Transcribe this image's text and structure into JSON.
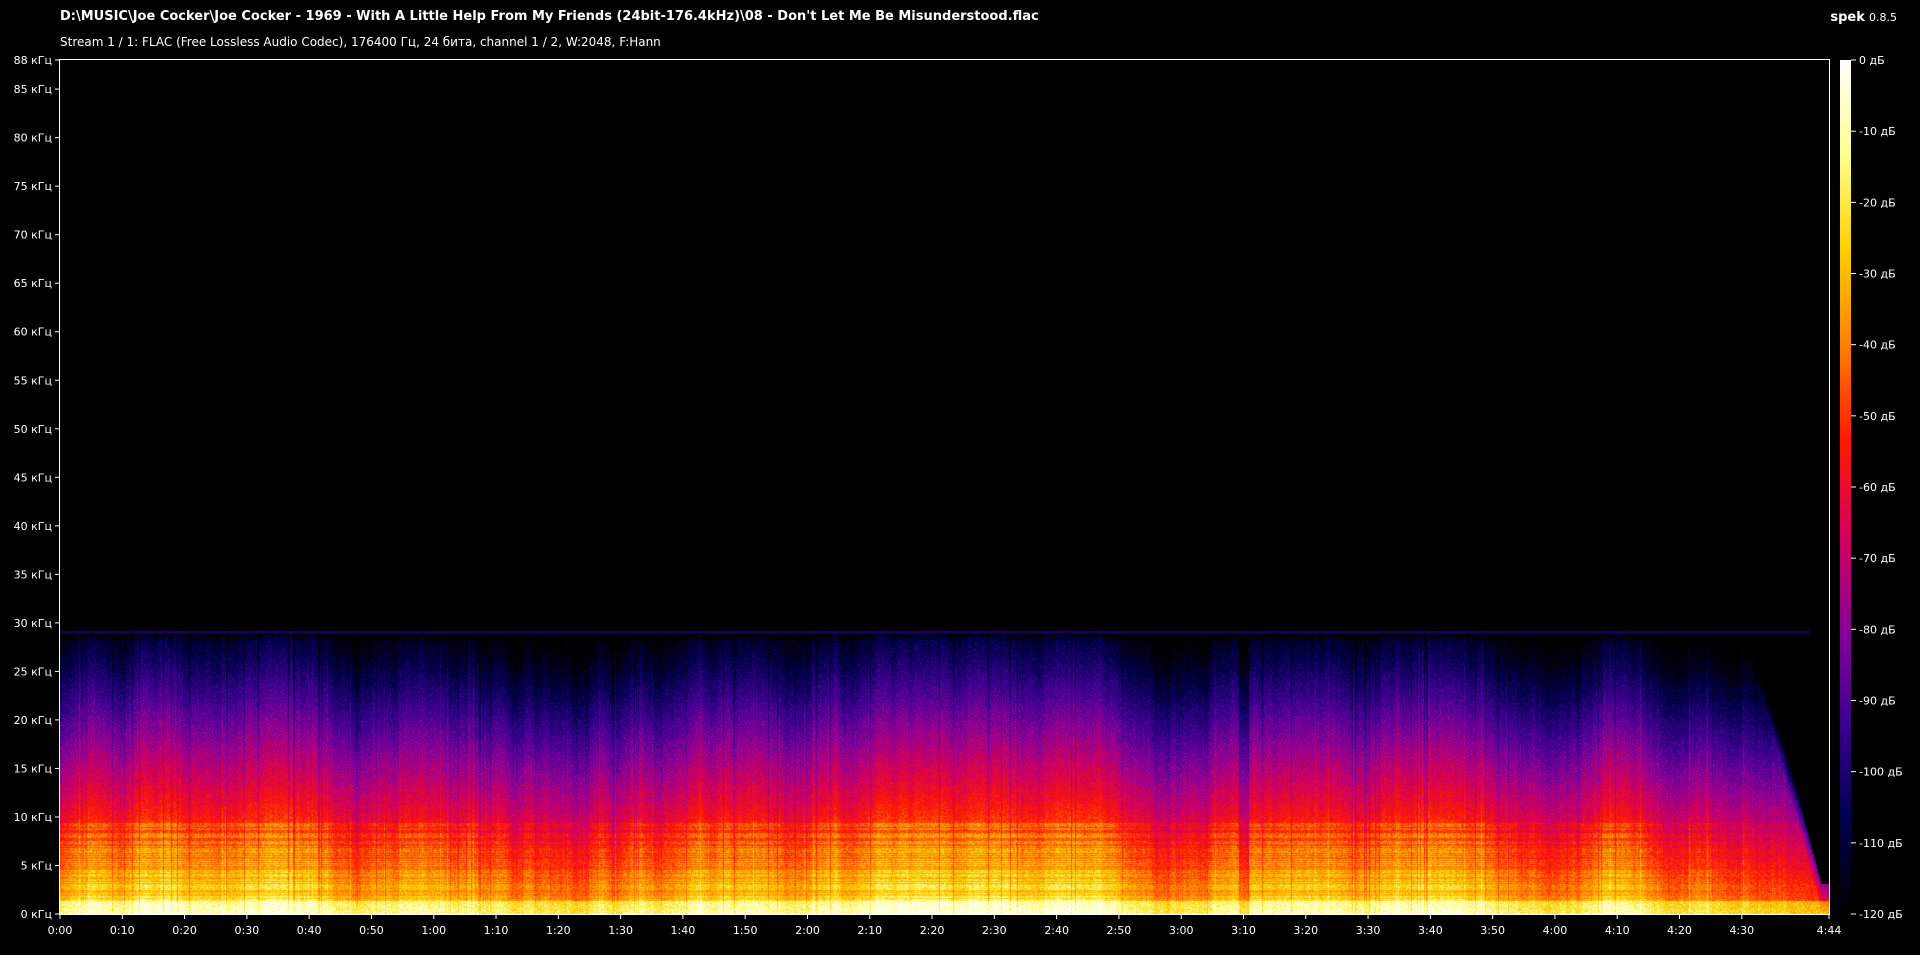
{
  "header": {
    "file_path": "D:\\MUSIC\\Joe Cocker\\Joe Cocker - 1969 - With A Little Help From My Friends (24bit-176.4kHz)\\08 - Don't Let Me Be Misunderstood.flac",
    "stream_info": "Stream 1 / 1: FLAC (Free Lossless Audio Codec), 176400 Гц, 24 бита, channel 1 / 2, W:2048, F:Hann",
    "app_name": "spek",
    "app_version": "0.8.5"
  },
  "chart_data": {
    "type": "heatmap",
    "x_axis": {
      "unit": "seconds",
      "range": [
        0,
        284
      ],
      "tick_values": [
        0,
        10,
        20,
        30,
        40,
        50,
        60,
        70,
        80,
        90,
        100,
        110,
        120,
        130,
        140,
        150,
        160,
        170,
        180,
        190,
        200,
        210,
        220,
        230,
        240,
        250,
        260,
        270,
        284
      ],
      "tick_labels": [
        "0:00",
        "0:10",
        "0:20",
        "0:30",
        "0:40",
        "0:50",
        "1:00",
        "1:10",
        "1:20",
        "1:30",
        "1:40",
        "1:50",
        "2:00",
        "2:10",
        "2:20",
        "2:30",
        "2:40",
        "2:50",
        "3:00",
        "3:10",
        "3:20",
        "3:30",
        "3:40",
        "3:50",
        "4:00",
        "4:10",
        "4:20",
        "4:30",
        "4:44"
      ]
    },
    "y_axis": {
      "unit": "kHz",
      "range": [
        0,
        88
      ],
      "tick_values": [
        0,
        5,
        10,
        15,
        20,
        25,
        30,
        35,
        40,
        45,
        50,
        55,
        60,
        65,
        70,
        75,
        80,
        85,
        88
      ],
      "tick_labels": [
        "0 кГц",
        "5 кГц",
        "10 кГц",
        "15 кГц",
        "20 кГц",
        "25 кГц",
        "30 кГц",
        "35 кГц",
        "40 кГц",
        "45 кГц",
        "50 кГц",
        "55 кГц",
        "60 кГц",
        "65 кГц",
        "70 кГц",
        "75 кГц",
        "80 кГц",
        "85 кГц",
        "88 кГц"
      ]
    },
    "color_scale": {
      "unit": "dB",
      "range": [
        -120,
        0
      ],
      "tick_values": [
        0,
        -10,
        -20,
        -30,
        -40,
        -50,
        -60,
        -70,
        -80,
        -90,
        -100,
        -110,
        -120
      ],
      "tick_labels": [
        "0 дБ",
        "-10 дБ",
        "-20 дБ",
        "-30 дБ",
        "-40 дБ",
        "-50 дБ",
        "-60 дБ",
        "-70 дБ",
        "-80 дБ",
        "-90 дБ",
        "-100 дБ",
        "-110 дБ",
        "-120 дБ"
      ],
      "colors": [
        "#000000",
        "#00004c",
        "#3a0090",
        "#8a0098",
        "#d4005a",
        "#ff1a00",
        "#ff8000",
        "#ffd000",
        "#ffff90",
        "#ffffff"
      ]
    },
    "content_upper_limit_khz": 31,
    "faint_line_khz": 29,
    "signal_fade_out_start_s": 271,
    "quiet_dip_time_s": 190
  }
}
